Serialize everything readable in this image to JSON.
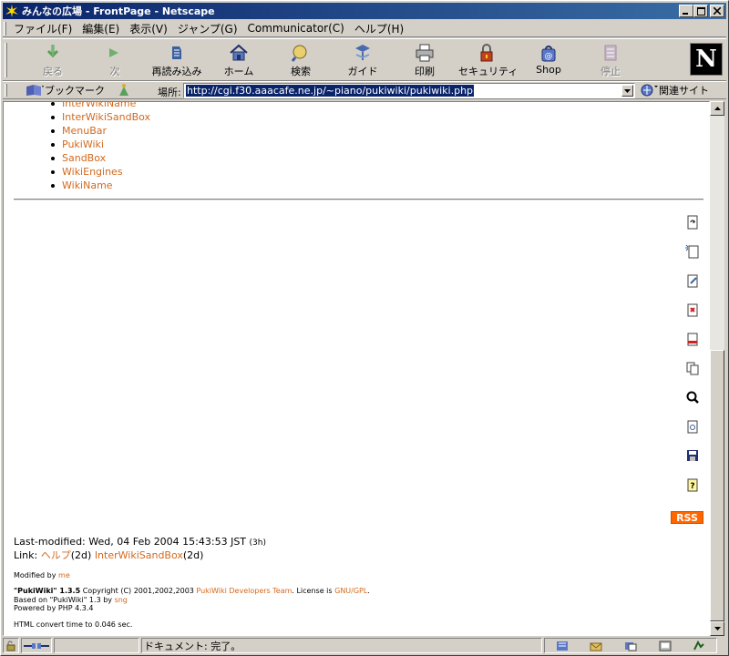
{
  "window": {
    "title": "みんなの広場 - FrontPage - Netscape"
  },
  "menu": {
    "items": [
      "ファイル(F)",
      "編集(E)",
      "表示(V)",
      "ジャンプ(G)",
      "Communicator(C)",
      "ヘルプ(H)"
    ]
  },
  "toolbar": {
    "back": "戻る",
    "forward": "次",
    "reload": "再読み込み",
    "home": "ホーム",
    "search": "検索",
    "guide": "ガイド",
    "print": "印刷",
    "security": "セキュリティ",
    "shop": "Shop",
    "stop": "停止",
    "logo": "N"
  },
  "location": {
    "bookmarks": "ブックマーク",
    "label": "場所:",
    "url": "http://cgi.f30.aaacafe.ne.jp/~piano/pukiwiki/pukiwiki.php",
    "related": "関連サイト"
  },
  "content": {
    "pages": [
      "InterWikiName",
      "InterWikiSandBox",
      "MenuBar",
      "PukiWiki",
      "SandBox",
      "WikiEngines",
      "WikiName"
    ],
    "rss": "RSS",
    "last_modified": "Last-modified: Wed, 04 Feb 2004 15:43:53 JST",
    "last_modified_ago": "(3h)",
    "link_label": "Link:",
    "link1": "ヘルプ",
    "link1_age": "(2d)",
    "link2": "InterWikiSandBox",
    "link2_age": "(2d)",
    "modified_by": "Modified by",
    "modified_by_name": "me",
    "pukiwiki_name": "\"PukiWiki\" 1.3.5",
    "copyright": "Copyright (C) 2001,2002,2003",
    "devteam": "PukiWiki Developers Team",
    "license_prefix": ". License is",
    "license": "GNU/GPL",
    "license_suffix": ".",
    "based_on": "Based on \"PukiWiki\" 1.3 by",
    "based_on_name": "sng",
    "powered": "Powered by PHP 4.3.4",
    "convert_time": "HTML convert time to 0.046 sec."
  },
  "status": {
    "text": "ドキュメント: 完了。"
  }
}
